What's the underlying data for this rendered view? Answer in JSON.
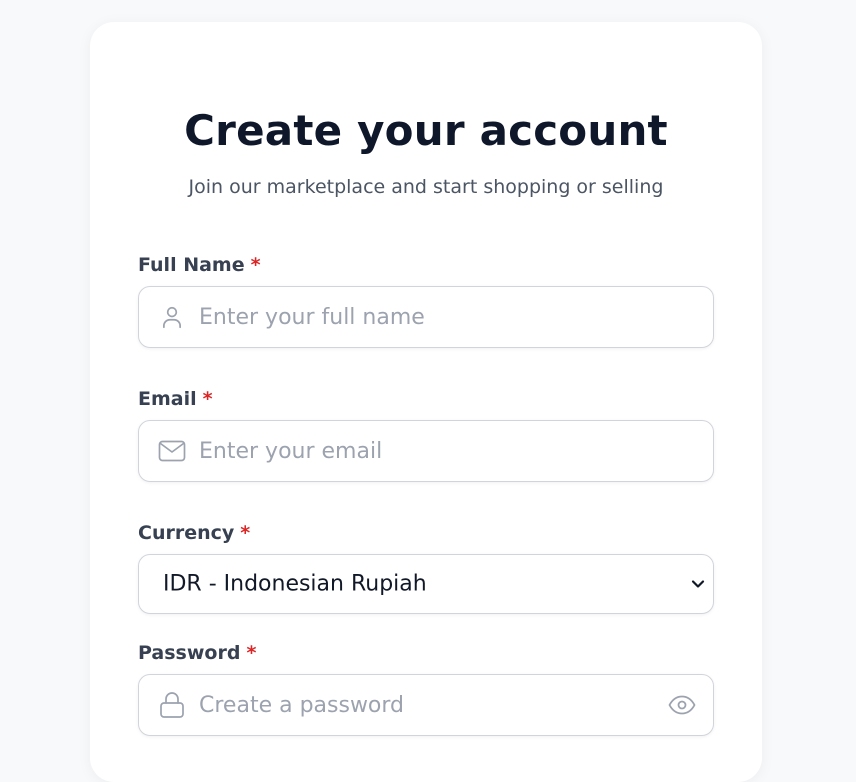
{
  "header": {
    "title": "Create your account",
    "subtitle": "Join our marketplace and start shopping or selling"
  },
  "form": {
    "required_marker": "*",
    "full_name": {
      "label": "Full Name",
      "placeholder": "Enter your full name",
      "icon": "user-icon"
    },
    "email": {
      "label": "Email",
      "placeholder": "Enter your email",
      "icon": "mail-icon"
    },
    "currency": {
      "label": "Currency",
      "selected": "IDR - Indonesian Rupiah",
      "icon": "chevron-down-icon"
    },
    "password": {
      "label": "Password",
      "placeholder": "Create a password",
      "icon": "lock-icon",
      "toggle_icon": "eye-icon"
    }
  },
  "colors": {
    "background": "#f8f9fb",
    "card": "#ffffff",
    "title": "#0f172a",
    "label": "#374151",
    "required": "#dc2626",
    "border": "#d1d5db",
    "placeholder": "#9ca3af",
    "icon": "#9ca3af"
  }
}
